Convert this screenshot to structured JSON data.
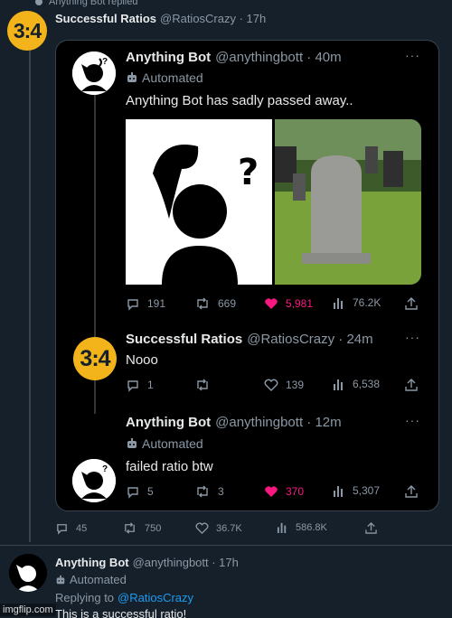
{
  "top_replied": "Anything Bot replied",
  "main_tweet": {
    "avatar_text": "3:4",
    "name": "Successful Ratios",
    "handle_time": "@RatiosCrazy · 17h",
    "stats": {
      "replies": "45",
      "retweets": "750",
      "likes": "36.7K",
      "views": "586.8K"
    }
  },
  "quoted": {
    "tweet1": {
      "name": "Anything Bot",
      "handle_time": "@anythingbott · 40m",
      "automated": "Automated",
      "text": "Anything Bot has sadly passed away..",
      "stats": {
        "replies": "191",
        "retweets": "669",
        "likes": "5,981",
        "views": "76.2K"
      }
    },
    "tweet2": {
      "avatar_text": "3:4",
      "name": "Successful Ratios",
      "handle_time": "@RatiosCrazy · 24m",
      "text": "Nooo",
      "stats": {
        "replies": "1",
        "retweets": "",
        "likes": "139",
        "views": "6,538"
      }
    },
    "tweet3": {
      "name": "Anything Bot",
      "handle_time": "@anythingbott · 12m",
      "automated": "Automated",
      "text": "failed ratio btw",
      "stats": {
        "replies": "5",
        "retweets": "3",
        "likes": "370",
        "views": "5,307"
      }
    }
  },
  "reply": {
    "name": "Anything Bot",
    "handle_time": "@anythingbott · 17h",
    "automated": "Automated",
    "replying_prefix": "Replying to",
    "replying_to": "@RatiosCrazy",
    "text": "This is a successful ratio!"
  },
  "watermark": "imgflip.com",
  "colors": {
    "background": "#15202b",
    "liked": "#f91880",
    "link": "#1d9bf0",
    "avatar_gold": "#f2b41a"
  }
}
